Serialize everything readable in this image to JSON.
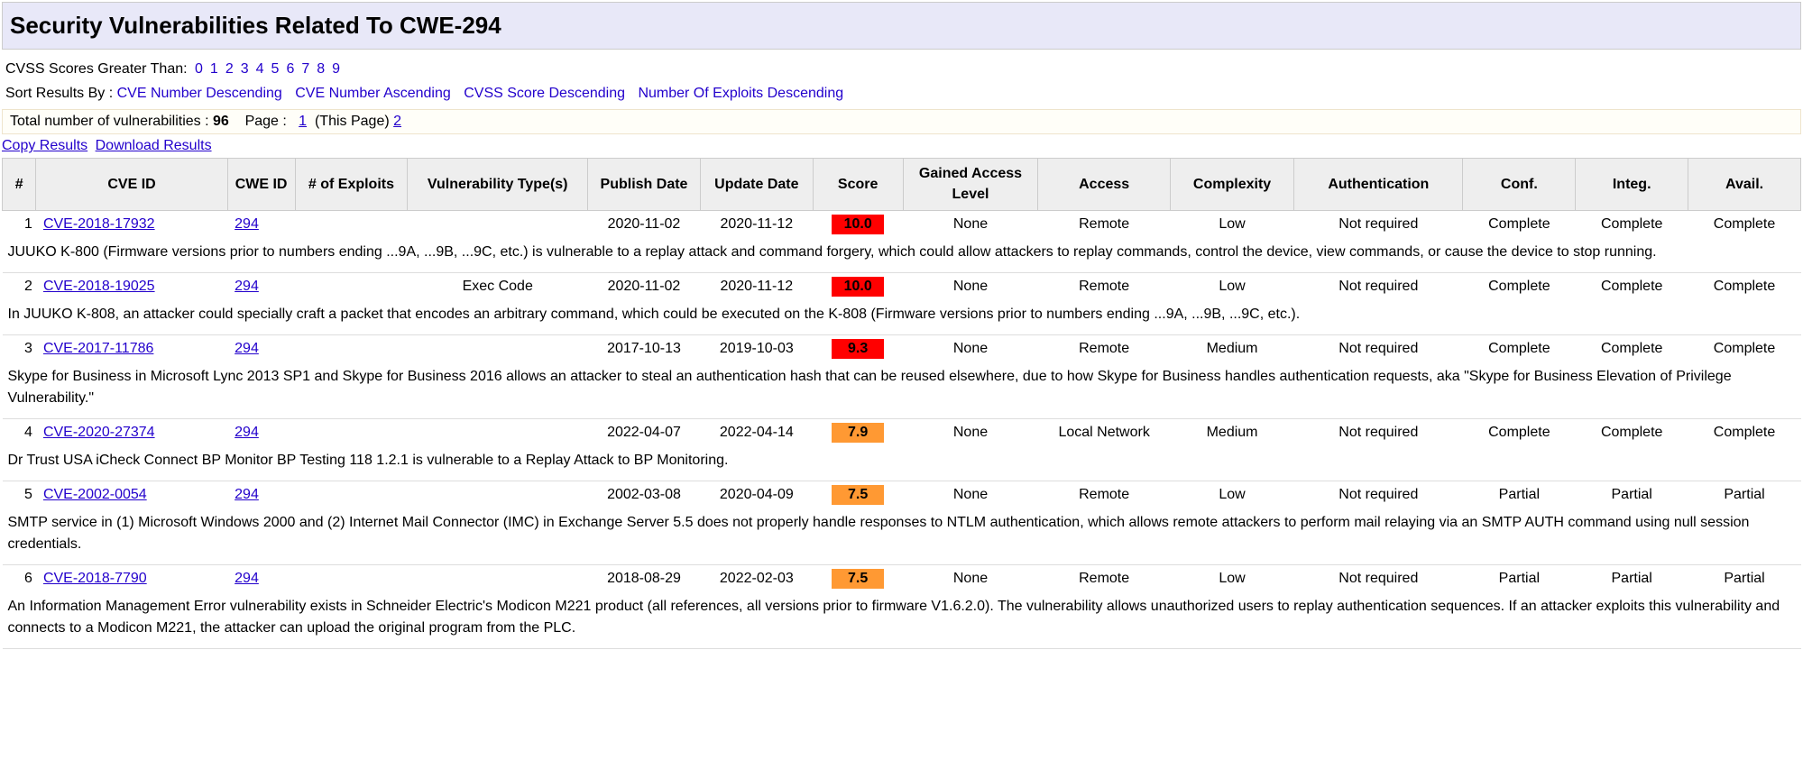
{
  "title": "Security Vulnerabilities Related To CWE-294",
  "filters": {
    "cvss_label": "CVSS Scores Greater Than: ",
    "cvss_values": [
      "0",
      "1",
      "2",
      "3",
      "4",
      "5",
      "6",
      "7",
      "8",
      "9"
    ],
    "sort_label": "Sort Results By : ",
    "sort_options": [
      "CVE Number Descending",
      "CVE Number Ascending",
      "CVSS Score Descending",
      "Number Of Exploits Descending"
    ]
  },
  "totals": {
    "label": "Total number of vulnerabilities : ",
    "count": "96",
    "page_label": "Page : ",
    "page_link_1": "1",
    "this_page": "(This Page)",
    "page_link_2": "2"
  },
  "result_links": {
    "copy": "Copy Results",
    "download": "Download Results"
  },
  "columns": {
    "num": "#",
    "cve": "CVE ID",
    "cwe": "CWE ID",
    "exp": "# of Exploits",
    "type": "Vulnerability Type(s)",
    "pub": "Publish Date",
    "upd": "Update Date",
    "score": "Score",
    "gal": "Gained Access Level",
    "acc": "Access",
    "comp": "Complexity",
    "auth": "Authentication",
    "conf": "Conf.",
    "int": "Integ.",
    "avl": "Avail."
  },
  "rows": [
    {
      "n": "1",
      "cve": "CVE-2018-17932",
      "cwe": "294",
      "exp": "",
      "type": "",
      "pub": "2020-11-02",
      "upd": "2020-11-12",
      "score": "10.0",
      "score_class": "score-red",
      "gal": "None",
      "acc": "Remote",
      "comp": "Low",
      "auth": "Not required",
      "conf": "Complete",
      "int": "Complete",
      "avl": "Complete",
      "desc": "JUUKO K-800 (Firmware versions prior to numbers ending ...9A, ...9B, ...9C, etc.) is vulnerable to a replay attack and command forgery, which could allow attackers to replay commands, control the device, view commands, or cause the device to stop running."
    },
    {
      "n": "2",
      "cve": "CVE-2018-19025",
      "cwe": "294",
      "exp": "",
      "type": "Exec Code",
      "pub": "2020-11-02",
      "upd": "2020-11-12",
      "score": "10.0",
      "score_class": "score-red",
      "gal": "None",
      "acc": "Remote",
      "comp": "Low",
      "auth": "Not required",
      "conf": "Complete",
      "int": "Complete",
      "avl": "Complete",
      "desc": "In JUUKO K-808, an attacker could specially craft a packet that encodes an arbitrary command, which could be executed on the K-808 (Firmware versions prior to numbers ending ...9A, ...9B, ...9C, etc.)."
    },
    {
      "n": "3",
      "cve": "CVE-2017-11786",
      "cwe": "294",
      "exp": "",
      "type": "",
      "pub": "2017-10-13",
      "upd": "2019-10-03",
      "score": "9.3",
      "score_class": "score-red",
      "gal": "None",
      "acc": "Remote",
      "comp": "Medium",
      "auth": "Not required",
      "conf": "Complete",
      "int": "Complete",
      "avl": "Complete",
      "desc": "Skype for Business in Microsoft Lync 2013 SP1 and Skype for Business 2016 allows an attacker to steal an authentication hash that can be reused elsewhere, due to how Skype for Business handles authentication requests, aka \"Skype for Business Elevation of Privilege Vulnerability.\""
    },
    {
      "n": "4",
      "cve": "CVE-2020-27374",
      "cwe": "294",
      "exp": "",
      "type": "",
      "pub": "2022-04-07",
      "upd": "2022-04-14",
      "score": "7.9",
      "score_class": "score-orange",
      "gal": "None",
      "acc": "Local Network",
      "comp": "Medium",
      "auth": "Not required",
      "conf": "Complete",
      "int": "Complete",
      "avl": "Complete",
      "desc": "Dr Trust USA iCheck Connect BP Monitor BP Testing 118 1.2.1 is vulnerable to a Replay Attack to BP Monitoring."
    },
    {
      "n": "5",
      "cve": "CVE-2002-0054",
      "cwe": "294",
      "exp": "",
      "type": "",
      "pub": "2002-03-08",
      "upd": "2020-04-09",
      "score": "7.5",
      "score_class": "score-orange",
      "gal": "None",
      "acc": "Remote",
      "comp": "Low",
      "auth": "Not required",
      "conf": "Partial",
      "int": "Partial",
      "avl": "Partial",
      "desc": "SMTP service in (1) Microsoft Windows 2000 and (2) Internet Mail Connector (IMC) in Exchange Server 5.5 does not properly handle responses to NTLM authentication, which allows remote attackers to perform mail relaying via an SMTP AUTH command using null session credentials."
    },
    {
      "n": "6",
      "cve": "CVE-2018-7790",
      "cwe": "294",
      "exp": "",
      "type": "",
      "pub": "2018-08-29",
      "upd": "2022-02-03",
      "score": "7.5",
      "score_class": "score-orange",
      "gal": "None",
      "acc": "Remote",
      "comp": "Low",
      "auth": "Not required",
      "conf": "Partial",
      "int": "Partial",
      "avl": "Partial",
      "desc": "An Information Management Error vulnerability exists in Schneider Electric's Modicon M221 product (all references, all versions prior to firmware V1.6.2.0). The vulnerability allows unauthorized users to replay authentication sequences. If an attacker exploits this vulnerability and connects to a Modicon M221, the attacker can upload the original program from the PLC."
    }
  ]
}
